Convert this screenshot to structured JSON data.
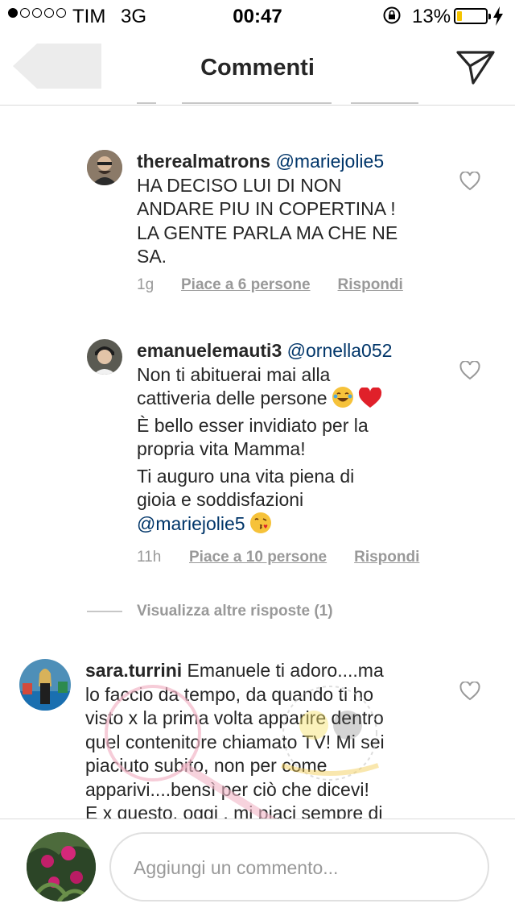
{
  "status_bar": {
    "carrier": "TIM",
    "network": "3G",
    "time": "00:47",
    "battery_percent": "13%",
    "signal_dots_filled": 1,
    "signal_dots_total": 5,
    "battery_level": 0.13
  },
  "header": {
    "title": "Commenti"
  },
  "comments": [
    {
      "username": "therealmatrons",
      "mention": "@mariejolie5",
      "lines": [
        "HA DECISO LUI DI NON",
        "ANDARE PIU IN COPERTINA !",
        "LA GENTE PARLA MA CHE NE",
        "SA."
      ],
      "time": "1g",
      "likes": "Piace a 6 persone",
      "reply": "Rispondi"
    },
    {
      "username": "emanuelemauti3",
      "mention": "@ornella052",
      "lines": [
        "Non ti abituerai mai alla",
        "cattiveria delle persone"
      ],
      "lines2": [
        "È bello esser invidiato per la",
        "propria vita Mamma!"
      ],
      "lines3": [
        "Ti auguro una vita piena di",
        "gioia e soddisfazioni"
      ],
      "mention2": "@mariejolie5",
      "time": "11h",
      "likes": "Piace a 10 persone",
      "reply": "Rispondi"
    }
  ],
  "view_more": "Visualizza altre risposte (1)",
  "third_comment": {
    "username": "sara.turrini",
    "first_line": "Emanuele ti adoro....ma",
    "lines": [
      "lo faccio da tempo, da quando ti ho",
      "visto x la prima volta apparire dentro",
      "quel contenitore chiamato TV! Mi sei",
      "piaciuto subito, non per come",
      "apparivi....bensì per ciò che dicevi!",
      "E x questo, oggi , mi piaci sempre di"
    ]
  },
  "input": {
    "placeholder": "Aggiungi un commento..."
  },
  "icons": {
    "back": "back-arrow-icon",
    "send": "send-icon",
    "heart": "heart-icon",
    "lock": "rotation-lock-icon",
    "bolt": "charging-bolt-icon"
  },
  "colors": {
    "mention": "#003569",
    "meta": "#999999",
    "battery": "#f5c400"
  }
}
